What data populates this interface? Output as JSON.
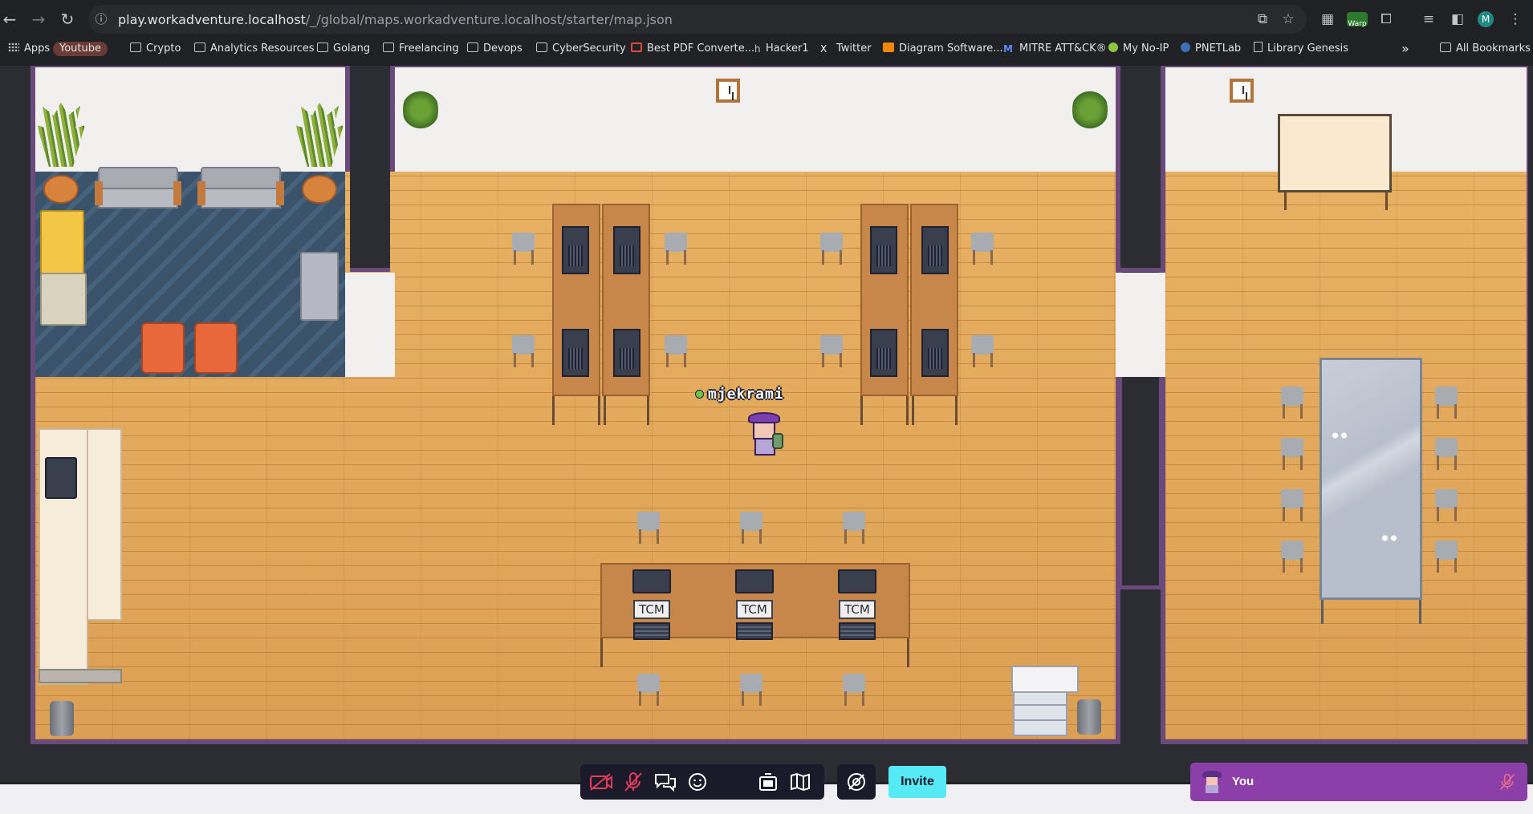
{
  "browser": {
    "url_host": "play.workadventure.localhost",
    "url_path": "/_/global/maps.workadventure.localhost/starter/map.json",
    "profile_initial": "M",
    "warp_badge": "Warp",
    "icons": [
      "back-icon",
      "forward-icon",
      "reload-icon",
      "site-info-icon",
      "cast-icon",
      "star-icon",
      "qr-icon",
      "warp-extension-icon",
      "extensions-icon",
      "media-icon",
      "sidepanel-icon",
      "menu-icon"
    ]
  },
  "bookmarks": {
    "items": [
      {
        "label": "Apps",
        "icon": "apps-grid-icon"
      },
      {
        "label": "Youtube",
        "icon": ""
      },
      {
        "label": "Crypto",
        "icon": "folder-icon"
      },
      {
        "label": "Analytics Resources",
        "icon": "folder-icon"
      },
      {
        "label": "Golang",
        "icon": "folder-icon"
      },
      {
        "label": "Freelancing",
        "icon": "folder-icon"
      },
      {
        "label": "Devops",
        "icon": "folder-icon"
      },
      {
        "label": "CyberSecurity",
        "icon": "folder-icon"
      },
      {
        "label": "Best PDF Converte...",
        "icon": "pdf-icon"
      },
      {
        "label": "Hacker1",
        "icon": "hackerone-icon"
      },
      {
        "label": "Twitter",
        "icon": "x-icon"
      },
      {
        "label": "Diagram Software...",
        "icon": "diagram-icon"
      },
      {
        "label": "MITRE ATT&CK®",
        "icon": "mitre-icon"
      },
      {
        "label": "My No-IP",
        "icon": "noip-icon"
      },
      {
        "label": "PNETLab",
        "icon": "pnetlab-icon"
      },
      {
        "label": "Library Genesis",
        "icon": "book-icon"
      }
    ],
    "overflow": "»",
    "all_bookmarks": "All Bookmarks"
  },
  "game": {
    "player_name": "mjekrami",
    "desk_labels": [
      "TCM",
      "TCM",
      "TCM"
    ]
  },
  "actionbar": {
    "invite_label": "Invite",
    "you_label": "You",
    "accent": "#56eaf7",
    "you_color": "#8c3fa8"
  }
}
